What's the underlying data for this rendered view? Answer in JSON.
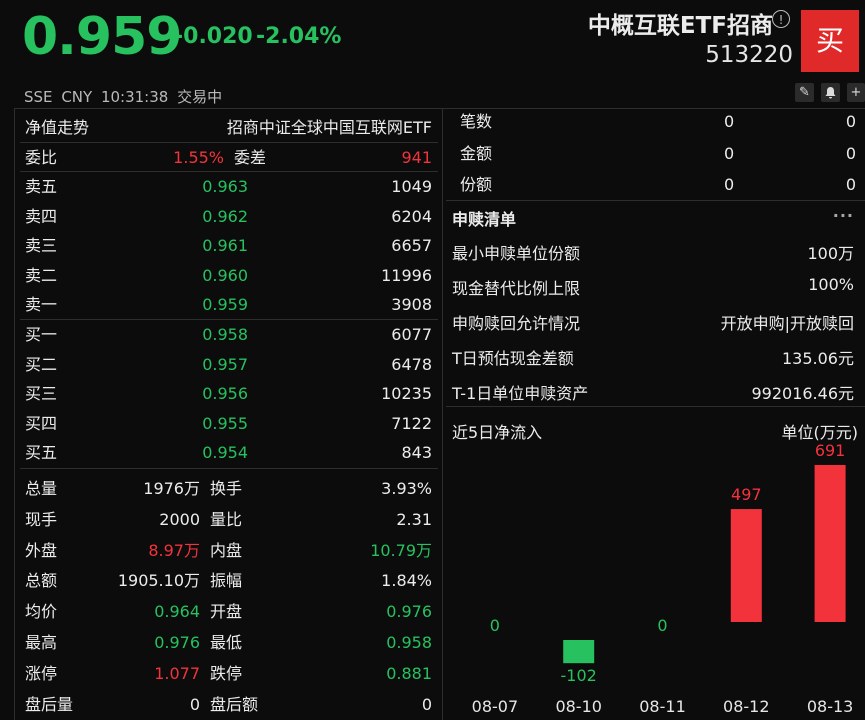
{
  "header": {
    "price": "0.959",
    "change": "-0.020",
    "change_pct": "-2.04%",
    "title": "中概互联ETF招商",
    "info_icon": "!",
    "code": "513220",
    "buy_label": "买",
    "exchange": "SSE",
    "currency": "CNY",
    "time": "10:31:38",
    "status": "交易中",
    "tools": [
      "pencil-icon",
      "bell-icon",
      "plus-icon"
    ]
  },
  "orderbook": {
    "nav_label": "净值走势",
    "index_name": "招商中证全球中国互联网ETF",
    "ratio_label": "委比",
    "ratio_value": "1.55%",
    "diff_label": "委差",
    "diff_value": "941",
    "asks": [
      {
        "label": "卖五",
        "price": "0.963",
        "volume": "1049"
      },
      {
        "label": "卖四",
        "price": "0.962",
        "volume": "6204"
      },
      {
        "label": "卖三",
        "price": "0.961",
        "volume": "6657"
      },
      {
        "label": "卖二",
        "price": "0.960",
        "volume": "11996"
      },
      {
        "label": "卖一",
        "price": "0.959",
        "volume": "3908"
      }
    ],
    "bids": [
      {
        "label": "买一",
        "price": "0.958",
        "volume": "6077"
      },
      {
        "label": "买二",
        "price": "0.957",
        "volume": "6478"
      },
      {
        "label": "买三",
        "price": "0.956",
        "volume": "10235"
      },
      {
        "label": "买四",
        "price": "0.955",
        "volume": "7122"
      },
      {
        "label": "买五",
        "price": "0.954",
        "volume": "843"
      }
    ]
  },
  "stats": [
    {
      "l1": "总量",
      "v1": "1976万",
      "c1": "white",
      "l2": "换手",
      "v2": "3.93%",
      "c2": "white"
    },
    {
      "l1": "现手",
      "v1": "2000",
      "c1": "white",
      "l2": "量比",
      "v2": "2.31",
      "c2": "white"
    },
    {
      "l1": "外盘",
      "v1": "8.97万",
      "c1": "red",
      "l2": "内盘",
      "v2": "10.79万",
      "c2": "green"
    },
    {
      "l1": "总额",
      "v1": "1905.10万",
      "c1": "white",
      "l2": "振幅",
      "v2": "1.84%",
      "c2": "white"
    },
    {
      "l1": "均价",
      "v1": "0.964",
      "c1": "green",
      "l2": "开盘",
      "v2": "0.976",
      "c2": "green"
    },
    {
      "l1": "最高",
      "v1": "0.976",
      "c1": "green",
      "l2": "最低",
      "v2": "0.958",
      "c2": "green"
    },
    {
      "l1": "涨停",
      "v1": "1.077",
      "c1": "red",
      "l2": "跌停",
      "v2": "0.881",
      "c2": "green"
    },
    {
      "l1": "盘后量",
      "v1": "0",
      "c1": "white",
      "l2": "盘后额",
      "v2": "0",
      "c2": "white"
    }
  ],
  "after_hours": [
    {
      "label": "笔数",
      "a": "0",
      "b": "0"
    },
    {
      "label": "金额",
      "a": "0",
      "b": "0"
    },
    {
      "label": "份额",
      "a": "0",
      "b": "0"
    }
  ],
  "creation": {
    "title": "申赎清单",
    "more": "···",
    "items": [
      {
        "label": "最小申赎单位份额",
        "value": "100万"
      },
      {
        "label": "现金替代比例上限",
        "value": "100%"
      },
      {
        "label": "申购赎回允许情况",
        "value": "开放申购|开放赎回"
      },
      {
        "label": "T日预估现金差额",
        "value": "135.06元"
      },
      {
        "label": "T-1日单位申赎资产",
        "value": "992016.46元"
      }
    ]
  },
  "flow": {
    "title": "近5日净流入",
    "unit": "单位(万元)"
  },
  "chart_data": {
    "type": "bar",
    "title": "近5日净流入",
    "ylabel": "单位(万元)",
    "categories": [
      "08-07",
      "08-10",
      "08-11",
      "08-12",
      "08-13"
    ],
    "values": [
      0,
      -102,
      0,
      497,
      691
    ],
    "colors": {
      "positive": "#f2333c",
      "negative": "#27c15f",
      "zero": "#27c15f"
    }
  }
}
